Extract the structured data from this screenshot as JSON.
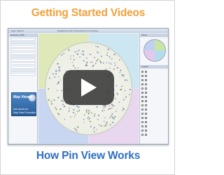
{
  "card": {
    "headline_top": "Getting Started Videos",
    "headline_bottom": "How Pin View Works",
    "headline_top_color": "#f2a13b",
    "headline_bottom_color": "#2d6fc0"
  },
  "app": {
    "title": "Note: Search",
    "document": "Registering SIO Connections from All Views",
    "left_panel": {
      "header": "Datasets (108)",
      "rows": [
        "",
        "",
        "",
        "",
        "",
        "",
        "",
        "",
        "",
        "",
        ""
      ],
      "promo": {
        "title": "Map Views",
        "line1": "Ask about our",
        "line2": "Map View Promotion"
      }
    },
    "right_panel": {
      "header": "Views",
      "legend_header": "Legend",
      "legend_items": [
        {
          "label": "",
          "color": "#e6a23c"
        },
        {
          "label": "",
          "color": "#6fa8dc"
        },
        {
          "label": "",
          "color": "#93c47d"
        },
        {
          "label": "",
          "color": "#c27ba0"
        },
        {
          "label": "",
          "color": "#f6b26b"
        },
        {
          "label": "",
          "color": "#8e7cc3"
        },
        {
          "label": "",
          "color": "#76a5af"
        },
        {
          "label": "",
          "color": "#e06666"
        },
        {
          "label": "",
          "color": "#ffd966"
        },
        {
          "label": "",
          "color": "#a4c2f4"
        },
        {
          "label": "",
          "color": "#b6d7a8"
        },
        {
          "label": "",
          "color": "#d5a6bd"
        },
        {
          "label": "",
          "color": "#9fc5e8"
        },
        {
          "label": "",
          "color": "#f9cb9c"
        },
        {
          "label": "",
          "color": "#b4a7d6"
        },
        {
          "label": "",
          "color": "#cccccc"
        }
      ]
    },
    "canvas": {
      "quadrant_labels": [
        "",
        "",
        "",
        ""
      ]
    },
    "play_button_icon": "play-icon"
  }
}
